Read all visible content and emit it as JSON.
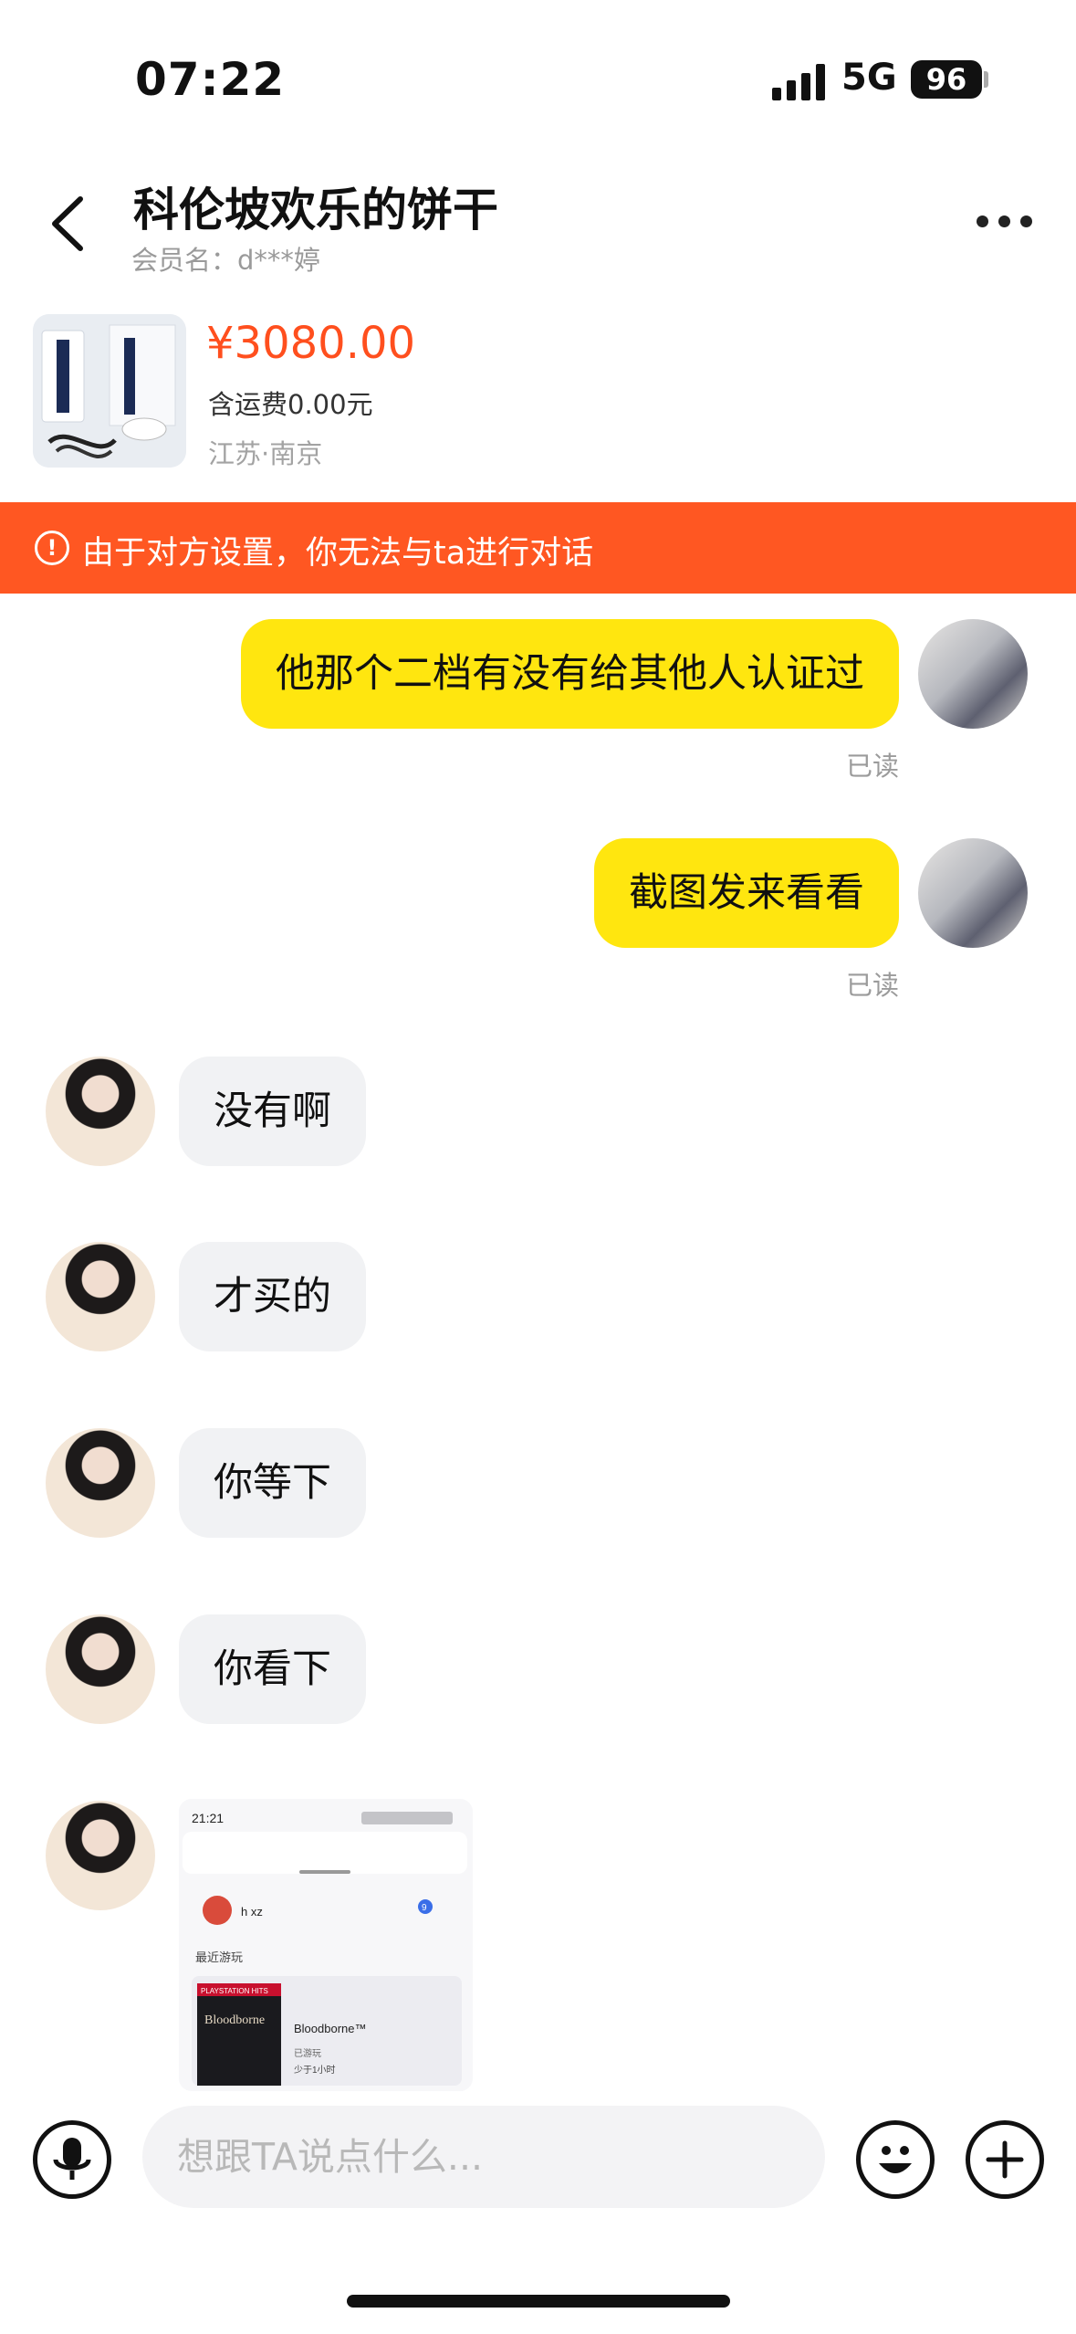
{
  "status": {
    "time": "07:22",
    "network": "5G",
    "battery": "96"
  },
  "header": {
    "title": "科伦坡欢乐的饼干",
    "member_label": "会员名：d***婷"
  },
  "product": {
    "price": "¥3080.00",
    "shipping": "含运费0.00元",
    "location": "江苏·南京"
  },
  "warning": {
    "text": "由于对方设置，你无法与ta进行对话"
  },
  "messages": [
    {
      "side": "me",
      "text": "他那个二档有没有给其他人认证过",
      "status": "已读"
    },
    {
      "side": "me",
      "text": "截图发来看看",
      "status": "已读"
    },
    {
      "side": "them",
      "text": "没有啊"
    },
    {
      "side": "them",
      "text": "才买的"
    },
    {
      "side": "them",
      "text": "你等下"
    },
    {
      "side": "them",
      "text": "你看下"
    }
  ],
  "screenshot": {
    "time": "21:21",
    "username": "h xz",
    "notification_count": "9",
    "section_label": "最近游玩",
    "game_title": "Bloodborne™",
    "game_logo": "Bloodborne",
    "game_badge": "PLAYSTATION HITS",
    "game_status": "已游玩",
    "play_time": "少于1小时"
  },
  "input": {
    "placeholder": "想跟TA说点什么..."
  },
  "colors": {
    "accent": "#ff4f1e",
    "warning_bg": "#ff5722",
    "my_bubble": "#ffe60f",
    "their_bubble": "#f1f2f4"
  },
  "icons": [
    "back-arrow-icon",
    "more-dots-icon",
    "alert-circle-icon",
    "microphone-icon",
    "emoji-icon",
    "plus-icon"
  ]
}
